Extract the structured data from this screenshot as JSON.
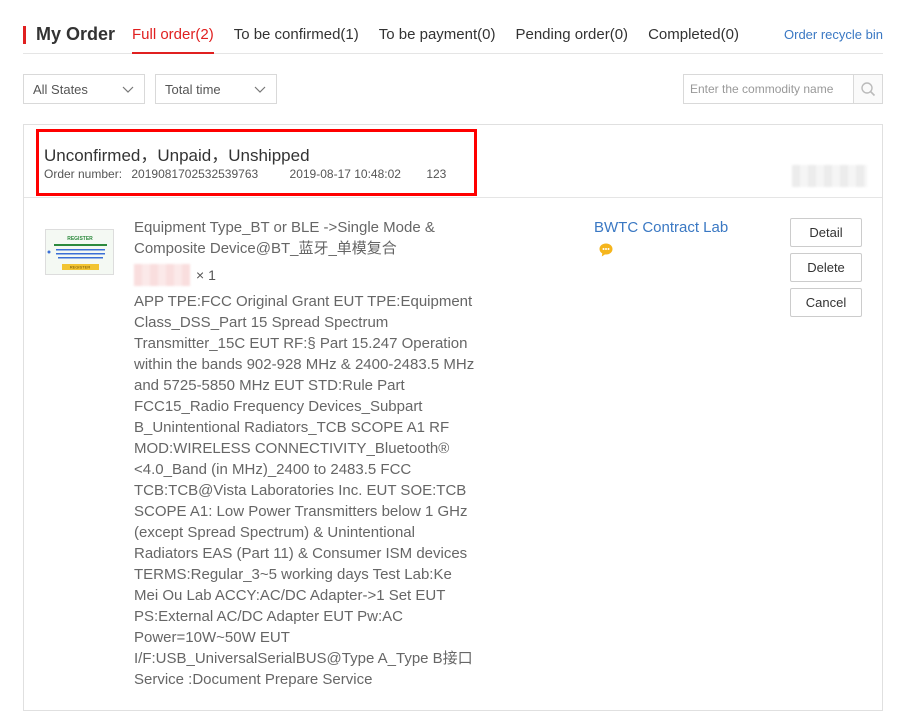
{
  "header": {
    "title": "My Order",
    "tabs": [
      {
        "label": "Full order(2)",
        "active": true
      },
      {
        "label": "To be confirmed(1)",
        "active": false
      },
      {
        "label": "To be payment(0)",
        "active": false
      },
      {
        "label": "Pending order(0)",
        "active": false
      },
      {
        "label": "Completed(0)",
        "active": false
      }
    ],
    "recycle_link": "Order recycle bin"
  },
  "filters": {
    "state_select": "All States",
    "time_select": "Total time",
    "search_placeholder": "Enter the commodity name"
  },
  "order": {
    "status": "Unconfirmed，Unpaid，Unshipped",
    "number_label": "Order number:",
    "number": "2019081702532539763",
    "datetime": "2019-08-17 10:48:02",
    "code": "123",
    "product_name": "Equipment Type_BT or BLE ->Single Mode & Composite Device@BT_蓝牙_单模复合",
    "quantity": "× 1",
    "description": "APP TPE:FCC Original Grant EUT TPE:Equipment Class_DSS_Part 15 Spread Spectrum Transmitter_15C EUT RF:§ Part 15.247 Operation within the bands 902-928 MHz & 2400-2483.5 MHz and 5725-5850 MHz EUT STD:Rule Part FCC15_Radio Frequency Devices_Subpart B_Unintentional Radiators_TCB SCOPE A1 RF MOD:WIRELESS CONNECTIVITY_Bluetooth® <4.0_Band (in MHz)_2400 to 2483.5 FCC TCB:TCB@Vista Laboratories Inc. EUT SOE:TCB SCOPE A1: Low Power Transmitters below 1 GHz (except Spread Spectrum) & Unintentional Radiators EAS (Part 11) & Consumer ISM devices TERMS:Regular_3~5 working days Test Lab:Ke Mei Ou Lab ACCY:AC/DC Adapter->1 Set EUT PS:External AC/DC Adapter EUT Pw:AC Power=10W~50W EUT I/F:USB_UniversalSerialBUS@Type A_Type B接口 Service :Document Prepare Service",
    "lab": "BWTC Contract Lab",
    "thumb_text": "REGISTER",
    "buttons": {
      "detail": "Detail",
      "delete": "Delete",
      "cancel": "Cancel"
    }
  },
  "colors": {
    "accent": "#e02020",
    "link": "#3a78c3",
    "highlight_box": "#ff0000"
  },
  "icons": {
    "select_arrow": "chevron-down-icon",
    "search": "search-icon",
    "chat": "chat-bubble-icon"
  }
}
